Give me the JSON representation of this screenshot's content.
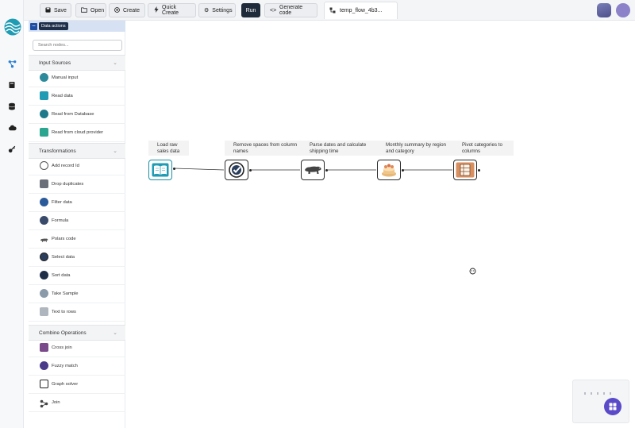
{
  "toolbar": {
    "save_label": "Save",
    "open_label": "Open",
    "create_label": "Create",
    "quick_create_label": "Quick Create",
    "settings_label": "Settings",
    "run_label": "Run",
    "generate_code_label": "Generate code",
    "tab_label": "temp_flow_4b3..."
  },
  "panel": {
    "header_label": "Data actions",
    "search_placeholder": "Search nodes...",
    "sections": [
      {
        "title": "Input Sources",
        "items": [
          "Manual input",
          "Read data",
          "Read from Database",
          "Read from cloud provider"
        ]
      },
      {
        "title": "Transformations",
        "items": [
          "Add record Id",
          "Drop duplicates",
          "Filter data",
          "Formula",
          "Polars code",
          "Select data",
          "Sort data",
          "Take Sample",
          "Text to rows"
        ]
      },
      {
        "title": "Combine Operations",
        "items": [
          "Cross join",
          "Fuzzy match",
          "Graph solver",
          "Join"
        ]
      }
    ]
  },
  "flow": {
    "nodes": [
      {
        "label": "Load raw sales data",
        "icon": "book-icon"
      },
      {
        "label": "Remove spaces from column names",
        "icon": "check-icon"
      },
      {
        "label": "Parse dates and calculate shipping time",
        "icon": "polar-bear-icon"
      },
      {
        "label": "Monthly summary by region and category",
        "icon": "summary-icon"
      },
      {
        "label": "Pivot categories to columns",
        "icon": "pivot-icon"
      }
    ]
  },
  "colors": {
    "accent": "#1f2a3a",
    "brand": "#1f9bb3",
    "fab": "#5a49c8",
    "panel_header": "#d6e2f4"
  }
}
